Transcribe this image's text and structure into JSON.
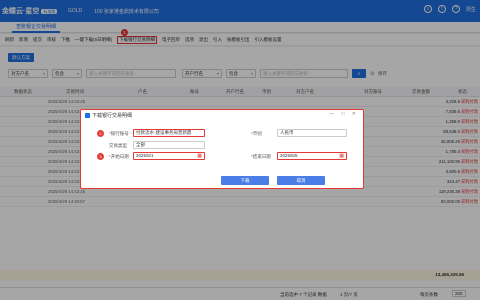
{
  "topbar": {
    "brand": "金蝶云·星空",
    "brand_tag": "标准版",
    "product": "GOLD",
    "company": "100 张家港金鼎技术有限公司",
    "user": "周生"
  },
  "tabs": {
    "active": "查账银企交易明细"
  },
  "toolbar": {
    "items": [
      "刷新",
      "新增",
      "提交",
      "审核",
      "下推",
      "一键下载(5日明细)",
      "下载银行交易明细",
      "电子回单",
      "选项",
      "退出",
      "引入",
      "按模板引出",
      "引入模板设置"
    ],
    "badge": "1"
  },
  "filters": {
    "field1": "对方户名",
    "op1": "包含",
    "placeholder1": "输入关键字或回车搜索",
    "field2": "开户行名",
    "op2": "包含",
    "placeholder2": "输入关键字或回车搜索",
    "search": "搜索",
    "reset": "保存",
    "scheme": "默认方案"
  },
  "grid": {
    "columns": [
      "数据状态",
      "交易时间",
      "户名",
      "账号",
      "开户行名",
      "币别",
      "对方户名",
      "对方账号",
      "交易金额",
      "状态"
    ],
    "rows": [
      {
        "time": "2025/4/29 14:42:25",
        "amount": "3,228.5",
        "status": "采购付款"
      },
      {
        "time": "2025/4/29 14:42:25",
        "amount": "7,839.5",
        "status": "采购付款"
      },
      {
        "time": "2025/4/29 14:42:25",
        "amount": "1,258.0",
        "status": "采购付款"
      },
      {
        "time": "2025/4/29 14:42:25",
        "amount": "88,538.0",
        "status": "采购付款"
      },
      {
        "time": "2025/4/29 14:42:25",
        "amount": "45,906.25",
        "status": "采购付款"
      },
      {
        "time": "2025/4/29 14:42:25",
        "amount": "1,785.0",
        "status": "采购付款"
      },
      {
        "time": "2025/4/29 14:42:25",
        "amount": "211,100.95",
        "status": "采购付款"
      },
      {
        "time": "2025/4/29 14:42:25",
        "amount": "3,500.5",
        "status": "采购付款"
      },
      {
        "time": "2025/4/29 14:42:25",
        "amount": "343.47",
        "status": "采购付款"
      },
      {
        "time": "2025/4/29 14:42:25",
        "amount": "119,236.39",
        "status": "采购付款"
      },
      {
        "time": "2025/4/29 14:40:57",
        "amount": "50,000.00",
        "status": "采购付款"
      }
    ],
    "total": "13,465,325.56"
  },
  "pager": {
    "info": "当前选中 7 个记录 数据",
    "page": "1 页/7 页",
    "per_page_label": "每页条数",
    "per_page": "200"
  },
  "dialog": {
    "title": "下载银行交易明细",
    "account_label": "银行账号",
    "account_value": "付款流水-建设事务局普新鼎",
    "currency_label": "币别",
    "currency_value": "人民币",
    "type_label": "交易类型",
    "type_value": "全部",
    "start_label": "开始日期",
    "start_value": "2025/5/1",
    "end_label": "结束日期",
    "end_value": "2025/5/5",
    "ok": "下载",
    "cancel": "取消",
    "badge2": "2",
    "badge3": "3"
  }
}
